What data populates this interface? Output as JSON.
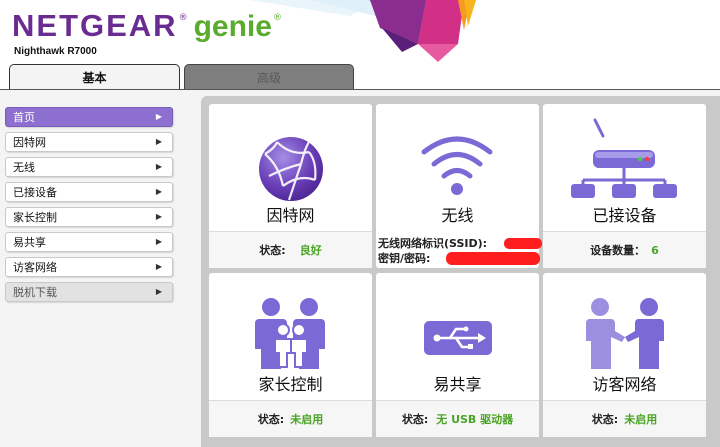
{
  "header": {
    "brand": "NETGEAR",
    "brand_reg": "®",
    "product": "genie",
    "product_reg": "®",
    "model": "Nighthawk R7000"
  },
  "tabs": [
    {
      "label": "基本",
      "active": true
    },
    {
      "label": "高级",
      "active": false
    }
  ],
  "sidebar": {
    "items": [
      {
        "label": "首页",
        "state": "active"
      },
      {
        "label": "因特网",
        "state": "normal"
      },
      {
        "label": "无线",
        "state": "normal"
      },
      {
        "label": "已接设备",
        "state": "normal"
      },
      {
        "label": "家长控制",
        "state": "normal"
      },
      {
        "label": "易共享",
        "state": "normal"
      },
      {
        "label": "访客网络",
        "state": "normal"
      },
      {
        "label": "脱机下载",
        "state": "disabled"
      }
    ],
    "arrow_glyph": "▶"
  },
  "cards": {
    "internet": {
      "title": "因特网",
      "status_label": "状态:",
      "status_value": "良好",
      "icon": "globe-icon"
    },
    "wireless": {
      "title": "无线",
      "ssid_label": "无线网络标识(SSID):",
      "key_label": "密钥/密码:",
      "icon": "wifi-icon"
    },
    "devices": {
      "title": "已接设备",
      "count_label": "设备数量：",
      "count_value": "6",
      "icon": "router-network-icon"
    },
    "parental": {
      "title": "家长控制",
      "status_label": "状态:",
      "status_value": "未启用",
      "icon": "family-icon"
    },
    "readyshare": {
      "title": "易共享",
      "status_label": "状态:",
      "status_value": "无 USB 驱动器",
      "icon": "usb-icon"
    },
    "guest": {
      "title": "访客网络",
      "status_label": "状态:",
      "status_value": "未启用",
      "icon": "handshake-icon"
    }
  },
  "colors": {
    "brand_purple": "#6a2c91",
    "brand_green": "#5aab2e",
    "sidebar_active": "#8d6fcf",
    "icon_purple": "#7b6ad6",
    "status_green": "#4aa526",
    "redaction": "#ff1e1e"
  }
}
